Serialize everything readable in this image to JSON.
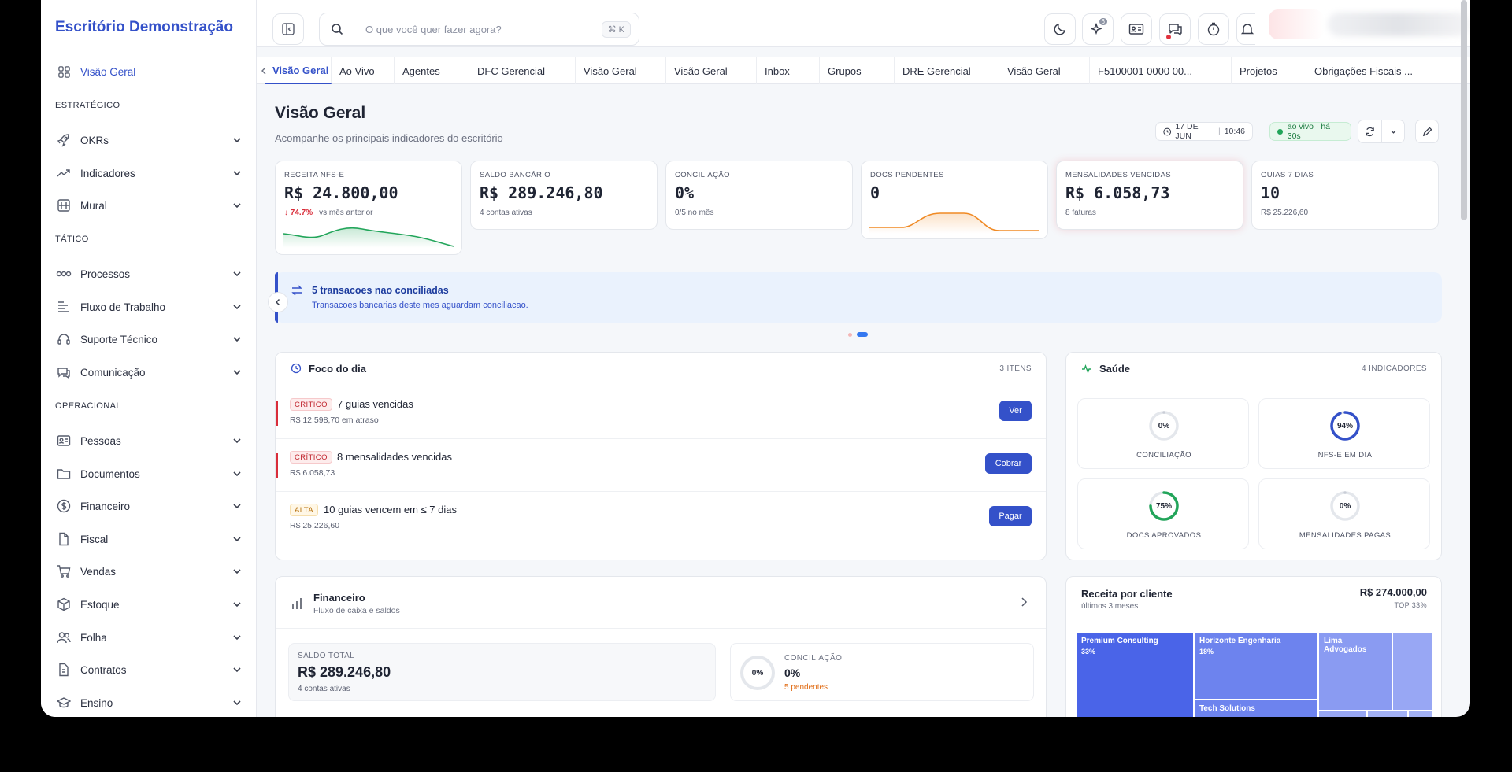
{
  "brand": "Escritório Demonstração",
  "sidebar": {
    "top_item": "Visão Geral",
    "sections": [
      {
        "title": "ESTRATÉGICO",
        "items": [
          "OKRs",
          "Indicadores",
          "Mural"
        ]
      },
      {
        "title": "TÁTICO",
        "items": [
          "Processos",
          "Fluxo de Trabalho",
          "Suporte Técnico",
          "Comunicação"
        ]
      },
      {
        "title": "OPERACIONAL",
        "items": [
          "Pessoas",
          "Documentos",
          "Financeiro",
          "Fiscal",
          "Vendas",
          "Estoque",
          "Folha",
          "Contratos",
          "Ensino"
        ]
      }
    ]
  },
  "topbar": {
    "search_placeholder": "O que você quer fazer agora?",
    "search_shortcut": "⌘ K",
    "ai_badge": "6"
  },
  "tabs": [
    "Visão Geral",
    "Ao Vivo",
    "Agentes",
    "DFC Gerencial",
    "Visão Geral",
    "Visão Geral",
    "Inbox",
    "Grupos",
    "DRE Gerencial",
    "Visão Geral",
    "F5100001 0000 00...",
    "Projetos",
    "Obrigações Fiscais ..."
  ],
  "page": {
    "title": "Visão Geral",
    "subtitle": "Acompanhe os principais indicadores do escritório",
    "date": "17 DE JUN",
    "time": "10:46",
    "live": "ao vivo · há 30s"
  },
  "kpis": [
    {
      "label": "RECEITA NFS-E",
      "value": "R$ 24.800,00",
      "delta": "↓ 74.7%",
      "sub": "vs mês anterior"
    },
    {
      "label": "SALDO BANCÁRIO",
      "value": "R$ 289.246,80",
      "sub": "4 contas ativas"
    },
    {
      "label": "CONCILIAÇÃO",
      "value": "0%",
      "sub": "0/5 no mês"
    },
    {
      "label": "DOCS PENDENTES",
      "value": "0",
      "sub": ""
    },
    {
      "label": "MENSALIDADES VENCIDAS",
      "value": "R$ 6.058,73",
      "sub": "8 faturas"
    },
    {
      "label": "GUIAS 7 DIAS",
      "value": "10",
      "sub": "R$ 25.226,60"
    }
  ],
  "banner": {
    "title": "5 transacoes nao conciliadas",
    "text": "Transacoes bancarias deste mes aguardam conciliacao."
  },
  "focus": {
    "title": "Foco do dia",
    "count": "3 ITENS",
    "items": [
      {
        "badge": "CRÍTICO",
        "title": "7 guias vencidas",
        "sub": "R$ 12.598,70 em atraso",
        "action": "Ver"
      },
      {
        "badge": "CRÍTICO",
        "title": "8 mensalidades vencidas",
        "sub": "R$ 6.058,73",
        "action": "Cobrar"
      },
      {
        "badge": "ALTA",
        "title": "10 guias vencem em ≤ 7 dias",
        "sub": "R$ 25.226,60",
        "action": "Pagar"
      }
    ]
  },
  "health": {
    "title": "Saúde",
    "count": "4 INDICADORES",
    "items": [
      {
        "label": "CONCILIAÇÃO",
        "value": "0%",
        "pct": 0,
        "color": "#c9cdd6"
      },
      {
        "label": "NFS-E EM DIA",
        "value": "94%",
        "pct": 94,
        "color": "#3451c9"
      },
      {
        "label": "DOCS APROVADOS",
        "value": "75%",
        "pct": 75,
        "color": "#22a55a"
      },
      {
        "label": "MENSALIDADES PAGAS",
        "value": "0%",
        "pct": 0,
        "color": "#c9cdd6"
      }
    ]
  },
  "financeiro": {
    "title": "Financeiro",
    "sub": "Fluxo de caixa e saldos",
    "saldo_label": "SALDO TOTAL",
    "saldo_value": "R$ 289.246,80",
    "saldo_sub": "4 contas ativas",
    "conc_label": "CONCILIAÇÃO",
    "conc_value": "0%",
    "conc_ring": "0%",
    "conc_sub": "5 pendentes"
  },
  "receita": {
    "title": "Receita por cliente",
    "sub": "últimos 3 meses",
    "total": "R$ 274.000,00",
    "top": "TOP 33%",
    "clients": [
      {
        "name": "Premium Consulting",
        "pct": "33%"
      },
      {
        "name": "Horizonte Engenharia",
        "pct": "18%"
      },
      {
        "name": "Lima Advogados",
        "pct": ""
      },
      {
        "name": "Tech Solutions",
        "pct": ""
      }
    ]
  },
  "colors": {
    "accent": "#3451c9",
    "danger": "#d92d3a",
    "success": "#22a55a",
    "warning": "#f08a24"
  }
}
